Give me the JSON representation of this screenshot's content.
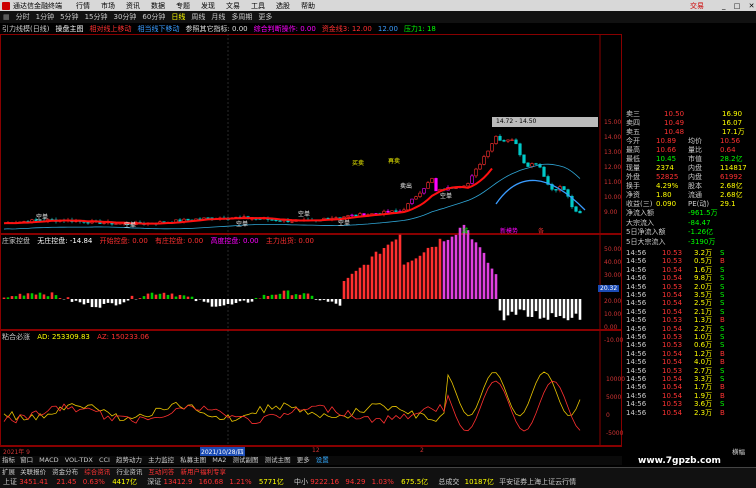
{
  "menu": {
    "title": "通达信金融终端",
    "items": [
      "行情",
      "市场",
      "资讯",
      "数据",
      "专题",
      "发现",
      "文易",
      "工具",
      "选股",
      "帮助"
    ],
    "trade": "交易"
  },
  "toolbar": {
    "periods": [
      "分时",
      "1分钟",
      "5分钟",
      "15分钟",
      "30分钟",
      "60分钟",
      "日线",
      "周线",
      "月线",
      "多周期",
      "更多"
    ],
    "active": "日线"
  },
  "indicator_line": {
    "name": "引力线模(日线)",
    "items": [
      {
        "text": "操盘主图",
        "color": "#ffffff"
      },
      {
        "text": "相对线上移动",
        "color": "#ff3030"
      },
      {
        "text": "相当线下移动",
        "color": "#3a9cff"
      },
      {
        "text": "参照其它指标: 0.00",
        "color": "#dddddd"
      },
      {
        "text": "综合判断操作: 0.00",
        "color": "#ff00ff"
      },
      {
        "text": "资金线3: 12.00",
        "color": "#ff3030"
      },
      {
        "text": "12.00",
        "color": "#3a9cff"
      },
      {
        "text": "压力1: 18",
        "color": "#00ff00"
      }
    ]
  },
  "main_chart": {
    "y_ticks": [
      "15.00",
      "14.00",
      "13.00",
      "12.00",
      "11.00",
      "10.00",
      "9.00"
    ],
    "highlight_label": "14.72 - 14.50",
    "annotations": [
      "买卖",
      "再卖",
      "空单",
      "卖出",
      "空单",
      "空单",
      "空单",
      "空单",
      "空单"
    ],
    "bottom_marks": [
      "减",
      "新模势",
      "各"
    ]
  },
  "volume_chart": {
    "name": "庄家控盘",
    "items": [
      {
        "text": "无庄控盘: -14.84",
        "color": "#ffffff"
      },
      {
        "text": "开始控盘: 0.00",
        "color": "#ff3030"
      },
      {
        "text": "有庄控盘: 0.00",
        "color": "#ff3030"
      },
      {
        "text": "高度控盘: 0.00",
        "color": "#ff00ff"
      },
      {
        "text": "主力出货: 0.00",
        "color": "#ff3030"
      }
    ],
    "y_ticks": [
      "50.00",
      "40.00",
      "30.00",
      "20.00",
      "10.00",
      "0.00",
      "-10.00"
    ],
    "tag": "20.32"
  },
  "osc_chart": {
    "name": "粘合必涨",
    "items": [
      {
        "text": "AD: 253309.83",
        "color": "#ffff00"
      },
      {
        "text": "AZ: 150233.06",
        "color": "#ff3030"
      }
    ],
    "y_ticks": [
      "10000",
      "5000",
      "0",
      "-5000"
    ]
  },
  "date_axis": {
    "labels": [
      "2021年 9",
      "2021/10/28/四",
      "12",
      "2"
    ]
  },
  "bottom_tabs": [
    "指标",
    "窗口",
    "MACD",
    "VOL-TDX",
    "CCI",
    "趋势动力",
    "主力监控",
    "私募主图",
    "MA2",
    "测试副图",
    "测试主图",
    "更多",
    "设置"
  ],
  "bottom_tabs2": [
    "扩展",
    "关联报价",
    "资金分布",
    "综合资讯",
    "行业资讯",
    "互动问答",
    "新用户福利专享"
  ],
  "side": {
    "quotes": [
      {
        "l": "卖三",
        "v": "10.50",
        "r": "16.90"
      },
      {
        "l": "卖四",
        "v": "10.49",
        "r": "16.07"
      },
      {
        "l": "卖五",
        "v": "10.48",
        "r": "17.1万"
      }
    ],
    "info": [
      {
        "l": "今开",
        "v": "10.89",
        "l2": "均价",
        "v2": "10.56",
        "c": "#ff3030"
      },
      {
        "l": "最高",
        "v": "10.66",
        "l2": "量比",
        "v2": "0.64",
        "c": "#ff3030"
      },
      {
        "l": "最低",
        "v": "10.45",
        "l2": "市值",
        "v2": "28.2亿",
        "c": "#00ff00"
      },
      {
        "l": "现量",
        "v": "2374",
        "l2": "内盘",
        "v2": "114817",
        "c": "#ffff00"
      },
      {
        "l": "外盘",
        "v": "52825",
        "l2": "内盘",
        "v2": "61992",
        "c": "#ff3030"
      },
      {
        "l": "换手",
        "v": "4.29%",
        "l2": "股本",
        "v2": "2.68亿",
        "c": "#ffff00"
      },
      {
        "l": "净资",
        "v": "1.80",
        "l2": "流通",
        "v2": "2.68亿",
        "c": "#ffff00"
      },
      {
        "l": "收益(三)",
        "v": "0.090",
        "l2": "PE(动)",
        "v2": "29.1",
        "c": "#ffff00"
      }
    ],
    "flows": [
      {
        "l": "净流入额",
        "v": "-961.5万",
        "c": "#00ff00"
      },
      {
        "l": "大宗流入",
        "v": "-84.47",
        "c": "#00ff00"
      },
      {
        "l": "5日净流入额",
        "v": "-1.26亿",
        "c": "#00ff00"
      },
      {
        "l": "5日大宗流入",
        "v": "-3190万",
        "c": "#00ff00"
      }
    ],
    "ticks": [
      {
        "t": "14:56",
        "p": "10.53",
        "q": "3.2万",
        "s": "S"
      },
      {
        "t": "14:56",
        "p": "10.53",
        "q": "0.5万",
        "s": "B"
      },
      {
        "t": "14:56",
        "p": "10.54",
        "q": "1.6万",
        "s": "S"
      },
      {
        "t": "14:56",
        "p": "10.54",
        "q": "9.8万",
        "s": "S"
      },
      {
        "t": "14:56",
        "p": "10.53",
        "q": "2.0万",
        "s": "S"
      },
      {
        "t": "14:56",
        "p": "10.54",
        "q": "3.5万",
        "s": "S"
      },
      {
        "t": "14:56",
        "p": "10.54",
        "q": "2.5万",
        "s": "S"
      },
      {
        "t": "14:56",
        "p": "10.54",
        "q": "2.1万",
        "s": "S"
      },
      {
        "t": "14:56",
        "p": "10.53",
        "q": "1.3万",
        "s": "B"
      },
      {
        "t": "14:56",
        "p": "10.54",
        "q": "2.2万",
        "s": "S"
      },
      {
        "t": "14:56",
        "p": "10.53",
        "q": "1.0万",
        "s": "S"
      },
      {
        "t": "14:56",
        "p": "10.53",
        "q": "0.6万",
        "s": "S"
      },
      {
        "t": "14:56",
        "p": "10.54",
        "q": "1.2万",
        "s": "B"
      },
      {
        "t": "14:56",
        "p": "10.54",
        "q": "4.0万",
        "s": "B"
      },
      {
        "t": "14:56",
        "p": "10.53",
        "q": "2.7万",
        "s": "S"
      },
      {
        "t": "14:56",
        "p": "10.54",
        "q": "3.3万",
        "s": "S"
      },
      {
        "t": "14:56",
        "p": "10.54",
        "q": "1.7万",
        "s": "B"
      },
      {
        "t": "14:56",
        "p": "10.54",
        "q": "1.9万",
        "s": "B"
      },
      {
        "t": "14:56",
        "p": "10.53",
        "q": "3.6万",
        "s": "S"
      },
      {
        "t": "14:56",
        "p": "10.54",
        "q": "2.3万",
        "s": "B"
      }
    ],
    "tab_label": "横幅"
  },
  "statusbar": {
    "items": [
      {
        "name": "上证",
        "val": "3451.41",
        "chg": "21.45",
        "pct": "0.63%",
        "amt": "4417亿"
      },
      {
        "name": "深证",
        "val": "13412.9",
        "chg": "160.68",
        "pct": "1.21%",
        "amt": "5771亿"
      },
      {
        "name": "中小",
        "val": "9222.16",
        "chg": "94.29",
        "pct": "1.03%",
        "amt": "675.5亿"
      }
    ],
    "total": "总成交",
    "total_val": "10187亿",
    "right": "平安证券上海上证云行情"
  },
  "watermark": "www.7gpzb.com",
  "chart_data": {
    "type": "candlestick",
    "ylim": [
      9.0,
      15.0
    ],
    "note_high": "14.72 - 14.50"
  }
}
